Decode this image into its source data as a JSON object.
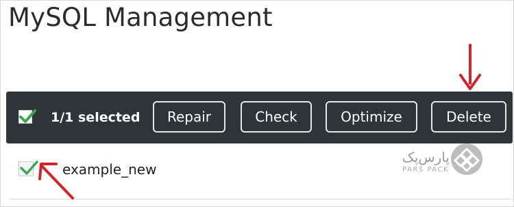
{
  "page": {
    "title": "MySQL Management"
  },
  "toolbar": {
    "select_all_checked": true,
    "selection_text": "1/1 selected",
    "buttons": {
      "repair": "Repair",
      "check": "Check",
      "optimize": "Optimize",
      "delete": "Delete"
    }
  },
  "databases": [
    {
      "name": "example_new",
      "checked": true
    }
  ],
  "watermark": {
    "logo_text": "پارس‌پک",
    "logo_subtext": "PARS PACK"
  },
  "colors": {
    "toolbar_bg": "#2f3438",
    "checkmark": "#3aa655",
    "annotation_arrow": "#d2232a"
  },
  "icons": {
    "select_all": "checkbox-checked-icon",
    "row_checkbox": "checkbox-checked-icon",
    "annotation": "arrow-icon",
    "logo": "pars-pack-logo-icon"
  }
}
